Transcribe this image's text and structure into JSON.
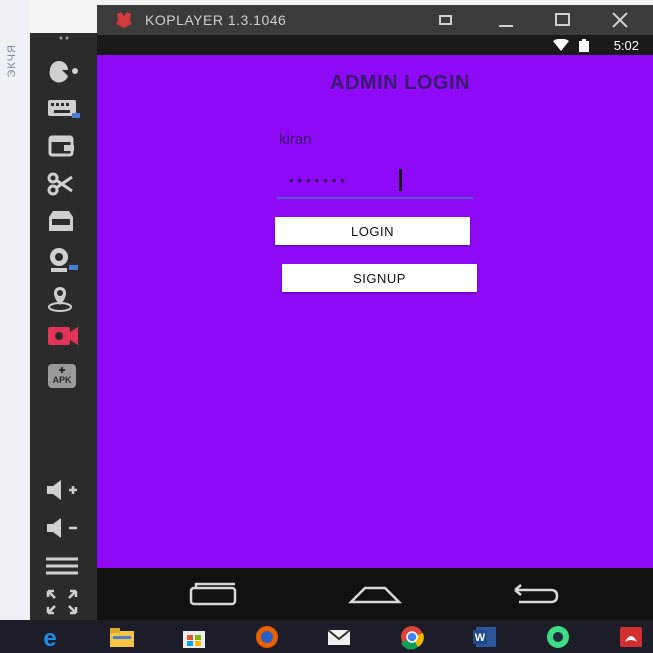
{
  "background": {
    "left_text": "ЭКЧЯ"
  },
  "window": {
    "title": "KOPLAYER 1.3.1046"
  },
  "status_bar": {
    "time": "5:02"
  },
  "screen": {
    "title": "ADMIN LOGIN",
    "username_value": "kiran",
    "password_masked": "•••••••",
    "login_label": "LOGIN",
    "signup_label": "SIGNUP"
  },
  "colors": {
    "screen_bg": "#8e09f5",
    "title_text": "#3a1a6a",
    "toolbar_bg": "#2b2b2b",
    "record_icon": "#e2335b"
  },
  "toolbar_icons": [
    "gamepad-icon",
    "keyboard-icon",
    "screenshot-icon",
    "scissors-icon",
    "inbox-icon",
    "camera-icon",
    "location-icon",
    "record-icon",
    "apk-install-icon",
    "volume-up-icon",
    "volume-down-icon",
    "menu-icon",
    "fullscreen-icon"
  ],
  "taskbar_icons": [
    "edge-icon",
    "file-explorer-icon",
    "store-icon",
    "firefox-icon",
    "mail-icon",
    "chrome-icon",
    "word-icon",
    "android-studio-icon",
    "acrobat-icon"
  ]
}
